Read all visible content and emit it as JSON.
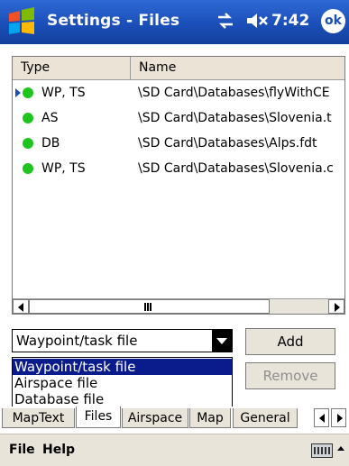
{
  "titlebar": {
    "title": "Settings - Files",
    "time": "7:42",
    "ok_label": "ok"
  },
  "listview": {
    "columns": [
      "Type",
      "Name"
    ],
    "rows": [
      {
        "type": "WP, TS",
        "name": "\\SD Card\\Databases\\flyWithCE",
        "current": true
      },
      {
        "type": "AS",
        "name": "\\SD Card\\Databases\\Slovenia.t",
        "current": false
      },
      {
        "type": "DB",
        "name": "\\SD Card\\Databases\\Alps.fdt",
        "current": false
      },
      {
        "type": "WP, TS",
        "name": "\\SD Card\\Databases\\Slovenia.c",
        "current": false
      }
    ],
    "status_color": "#1ec51e"
  },
  "combo": {
    "value": "Waypoint/task file",
    "options": [
      "Waypoint/task file",
      "Airspace file",
      "Database file"
    ],
    "selected_index": 0
  },
  "buttons": {
    "add": "Add",
    "remove": "Remove"
  },
  "tabs": [
    "MapText",
    "Files",
    "Airspace",
    "Map",
    "General"
  ],
  "active_tab": "Files",
  "menu": {
    "file": "File",
    "help": "Help"
  },
  "colors": {
    "titlebar": "#1b4fb8",
    "selection": "#0a1b8c"
  },
  "icons": [
    "windows-start-icon",
    "sync-icon",
    "volume-mute-icon",
    "keyboard-icon"
  ]
}
